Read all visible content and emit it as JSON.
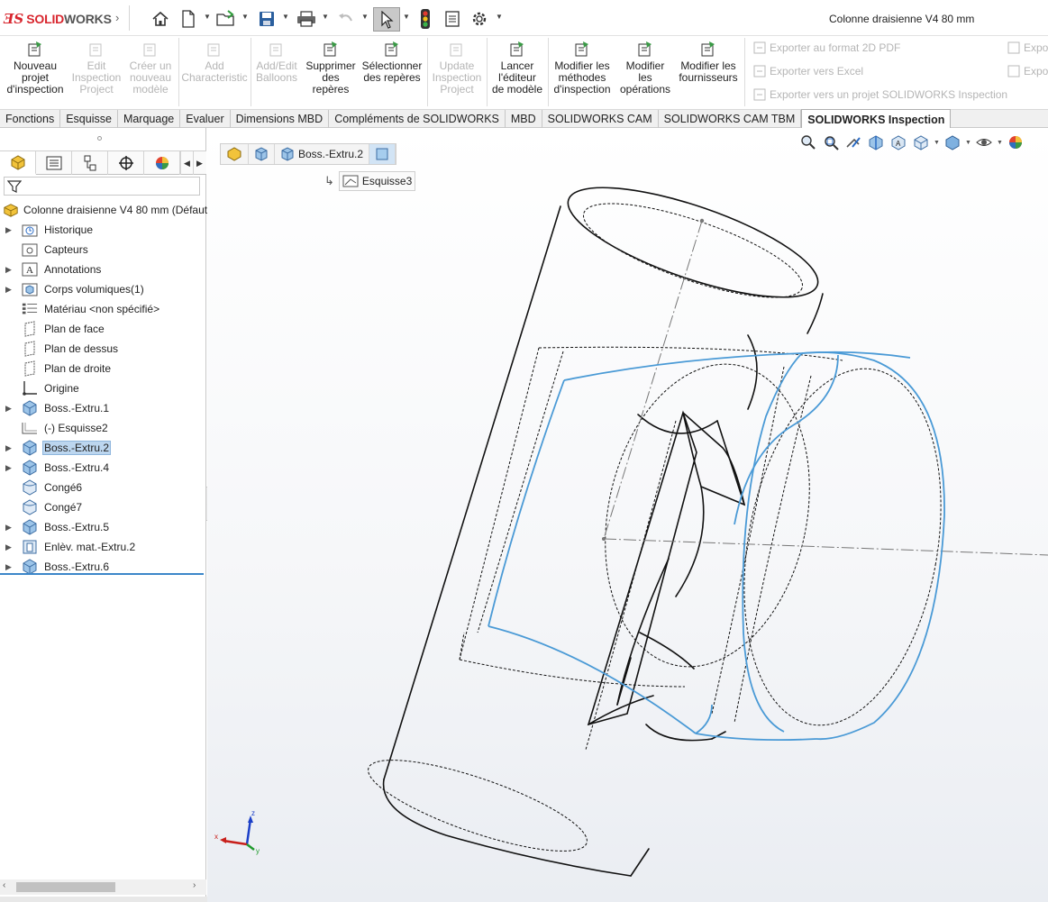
{
  "window": {
    "logo_brand": "SOLID",
    "logo_suffix": "WORKS",
    "document_title": "Colonne draisienne V4 80 mm"
  },
  "quick_access": {
    "icons": [
      "home-icon",
      "new-document-icon",
      "open-icon",
      "save-icon",
      "print-icon",
      "undo-icon",
      "select-pointer-icon",
      "traffic-light-icon",
      "file-properties-icon",
      "options-gear-icon"
    ]
  },
  "commands": [
    {
      "id": "nouveau-projet",
      "label": "Nouveau\nprojet\nd'inspection",
      "enabled": true
    },
    {
      "id": "edit-inspection",
      "label": "Edit\nInspection\nProject",
      "enabled": false
    },
    {
      "id": "creer-modele",
      "label": "Créer un\nnouveau\nmodèle",
      "enabled": false
    },
    {
      "id": "add-characteristic",
      "label": "Add\nCharacteristic",
      "enabled": false
    },
    {
      "id": "add-edit-balloons",
      "label": "Add/Edit\nBalloons",
      "enabled": false
    },
    {
      "id": "supprimer-reperes",
      "label": "Supprimer\ndes\nrepères",
      "enabled": true
    },
    {
      "id": "selectionner-reperes",
      "label": "Sélectionner\ndes repères",
      "enabled": true
    },
    {
      "id": "update-inspection",
      "label": "Update\nInspection\nProject",
      "enabled": false
    },
    {
      "id": "lancer-editeur",
      "label": "Lancer\nl'éditeur\nde modèle",
      "enabled": true
    },
    {
      "id": "modifier-methodes",
      "label": "Modifier les\nméthodes\nd'inspection",
      "enabled": true
    },
    {
      "id": "modifier-operations",
      "label": "Modifier\nles\nopérations",
      "enabled": true
    },
    {
      "id": "modifier-fournisseurs",
      "label": "Modifier les\nfournisseurs",
      "enabled": true
    }
  ],
  "export": {
    "pdf": "Exporter au format 2D PDF",
    "excel": "Exporter vers Excel",
    "project": "Exporter vers un projet SOLIDWORKS Inspection",
    "clipped_1": "Expo",
    "clipped_2": "Expo"
  },
  "tabs": [
    {
      "label": "Fonctions",
      "active": false
    },
    {
      "label": "Esquisse",
      "active": false
    },
    {
      "label": "Marquage",
      "active": false
    },
    {
      "label": "Evaluer",
      "active": false
    },
    {
      "label": "Dimensions MBD",
      "active": false
    },
    {
      "label": "Compléments de SOLIDWORKS",
      "active": false
    },
    {
      "label": "MBD",
      "active": false
    },
    {
      "label": "SOLIDWORKS CAM",
      "active": false
    },
    {
      "label": "SOLIDWORKS CAM TBM",
      "active": false
    },
    {
      "label": "SOLIDWORKS Inspection",
      "active": true
    }
  ],
  "tree": {
    "root": "Colonne draisienne V4 80 mm  (Défaut",
    "items": [
      {
        "label": "Historique",
        "icon": "history-folder-icon",
        "expandable": true,
        "selected": false
      },
      {
        "label": "Capteurs",
        "icon": "sensors-icon",
        "expandable": false,
        "selected": false
      },
      {
        "label": "Annotations",
        "icon": "annotations-icon",
        "expandable": true,
        "selected": false
      },
      {
        "label": "Corps volumiques(1)",
        "icon": "solid-bodies-icon",
        "expandable": true,
        "selected": false
      },
      {
        "label": "Matériau <non spécifié>",
        "icon": "material-icon",
        "expandable": false,
        "selected": false
      },
      {
        "label": "Plan de face",
        "icon": "plane-icon",
        "expandable": false,
        "selected": false
      },
      {
        "label": "Plan de dessus",
        "icon": "plane-icon",
        "expandable": false,
        "selected": false
      },
      {
        "label": "Plan de droite",
        "icon": "plane-icon",
        "expandable": false,
        "selected": false
      },
      {
        "label": "Origine",
        "icon": "origin-icon",
        "expandable": false,
        "selected": false
      },
      {
        "label": "Boss.-Extru.1",
        "icon": "extrude-icon",
        "expandable": true,
        "selected": false
      },
      {
        "label": "(-) Esquisse2",
        "icon": "sketch-icon",
        "expandable": false,
        "selected": false
      },
      {
        "label": "Boss.-Extru.2",
        "icon": "extrude-icon",
        "expandable": true,
        "selected": true
      },
      {
        "label": "Boss.-Extru.4",
        "icon": "extrude-icon",
        "expandable": true,
        "selected": false
      },
      {
        "label": "Congé6",
        "icon": "fillet-icon",
        "expandable": false,
        "selected": false
      },
      {
        "label": "Congé7",
        "icon": "fillet-icon",
        "expandable": false,
        "selected": false
      },
      {
        "label": "Boss.-Extru.5",
        "icon": "extrude-icon",
        "expandable": true,
        "selected": false
      },
      {
        "label": "Enlèv. mat.-Extru.2",
        "icon": "cut-extrude-icon",
        "expandable": true,
        "selected": false
      },
      {
        "label": "Boss.-Extru.6",
        "icon": "extrude-icon",
        "expandable": true,
        "selected": false
      }
    ]
  },
  "breadcrumb": {
    "feature": "Boss.-Extru.2",
    "sketch": "Esquisse3"
  },
  "triad": {
    "x": "x",
    "y": "y",
    "z": "z"
  },
  "colors": {
    "brand_red": "#d8262e",
    "selection_blue": "#3c86c9",
    "highlight_edge": "#4a9ad6"
  }
}
